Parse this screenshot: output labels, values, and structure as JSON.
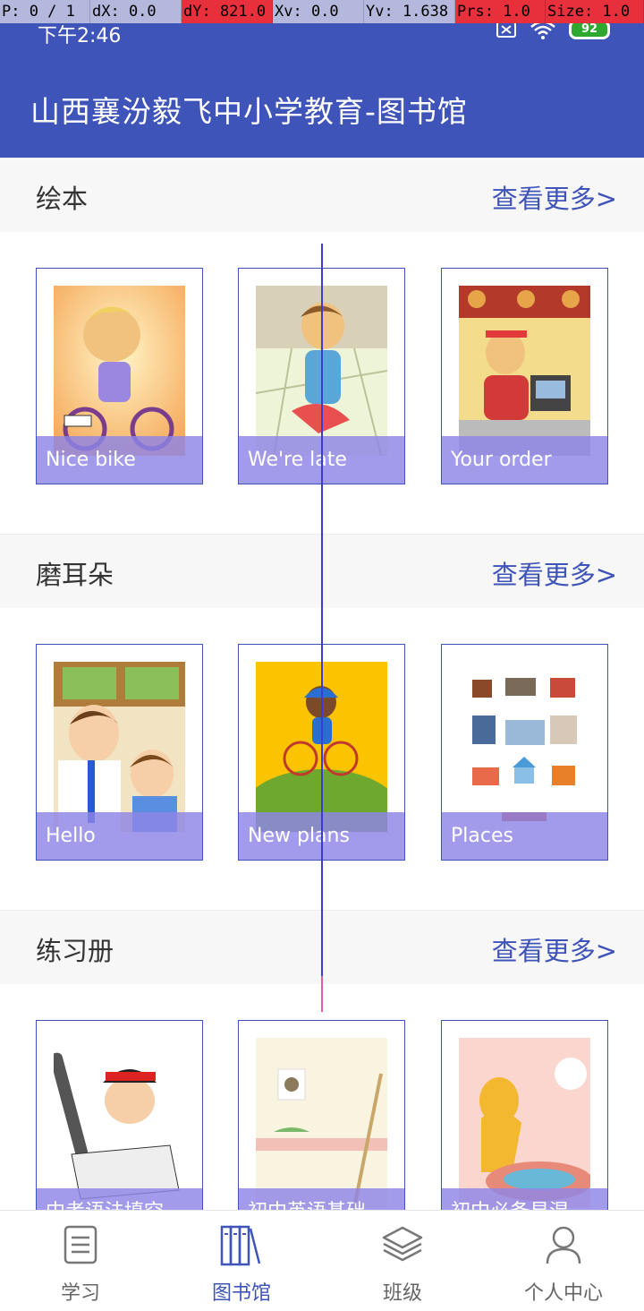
{
  "debug": {
    "p": "P: 0 / 1",
    "dx": "dX: 0.0",
    "dy": "dY: 821.0",
    "xv": "Xv: 0.0",
    "yv": "Yv: 1.638",
    "prs": "Prs: 1.0",
    "size": "Size: 1.0"
  },
  "status": {
    "time": "下午2:46",
    "battery": "92",
    "icons": [
      "sim-off-icon",
      "wifi-icon",
      "battery-icon"
    ]
  },
  "header": {
    "title": "山西襄汾毅飞中小学教育-图书馆"
  },
  "sections": [
    {
      "title": "绘本",
      "more": "查看更多>",
      "items": [
        {
          "caption": "Nice bike",
          "thumb": "boy-on-bike"
        },
        {
          "caption": "We're late",
          "thumb": "boy-running"
        },
        {
          "caption": "Your order",
          "thumb": "fast-food-counter"
        }
      ]
    },
    {
      "title": "磨耳朵",
      "more": "查看更多>",
      "items": [
        {
          "caption": "Hello",
          "thumb": "teacher-and-boy"
        },
        {
          "caption": "New plans",
          "thumb": "kid-cycling-hill"
        },
        {
          "caption": "Places",
          "thumb": "city-buildings"
        }
      ]
    },
    {
      "title": "练习册",
      "more": "查看更多>",
      "items": [
        {
          "caption": "中考语法填空",
          "thumb": "student-studying"
        },
        {
          "caption": "初中英语基础",
          "thumb": "room-wall"
        },
        {
          "caption": "初中必备易混",
          "thumb": "girl-in-raincoat"
        }
      ]
    }
  ],
  "nav": [
    {
      "label": "学习",
      "icon": "document-icon",
      "active": false
    },
    {
      "label": "图书馆",
      "icon": "library-icon",
      "active": true
    },
    {
      "label": "班级",
      "icon": "layers-icon",
      "active": false
    },
    {
      "label": "个人中心",
      "icon": "person-icon",
      "active": false
    }
  ],
  "colors": {
    "primary": "#3f54b8",
    "caption_bg": "#8d85e6",
    "section_bg": "#f7f7f7"
  }
}
